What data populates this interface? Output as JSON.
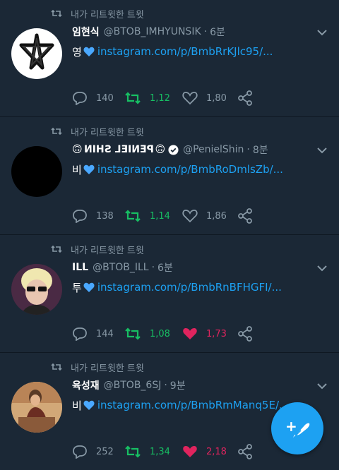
{
  "colors": {
    "background": "#1b2836",
    "link": "#1da1f2",
    "retweet_active": "#17bf63",
    "like_active": "#e0245e",
    "muted": "#8899a6"
  },
  "tweets": [
    {
      "retweet_label": "내가 리트윗한 트윗",
      "name": "임현식",
      "handle": "@BTOB_IMHYUNSIK",
      "separator": "·",
      "time": "6분",
      "text": "영",
      "link": "instagram.com/p/BmbRrKJlc95/...",
      "replies": "140",
      "retweets": "1,122",
      "likes": "1,802",
      "liked": false,
      "avatar": "star"
    },
    {
      "retweet_label": "내가 리트윗한 트윗",
      "name_emoji_left": "🙃",
      "name": "PENIEL SHIN",
      "name_emoji_right": "🙃",
      "handle": "@PenielShin",
      "separator": "·",
      "time": "8분",
      "text": "비",
      "link": "instagram.com/p/BmbRoDmlsZb/...",
      "replies": "138",
      "retweets": "1,145",
      "likes": "1,863",
      "liked": false,
      "avatar": "black",
      "verified": true
    },
    {
      "retweet_label": "내가 리트윗한 트윗",
      "name": "ILL",
      "handle": "@BTOB_ILL",
      "separator": "·",
      "time": "6분",
      "text": "투",
      "link": "instagram.com/p/BmbRnBFHGFI/...",
      "replies": "144",
      "retweets": "1,080",
      "likes": "1,731",
      "liked": true,
      "avatar": "person-blond"
    },
    {
      "retweet_label": "내가 리트윗한 트윗",
      "name": "육성재",
      "handle": "@BTOB_6SJ",
      "separator": "·",
      "time": "9분",
      "text": "비",
      "link": "instagram.com/p/BmbRmManq5E/...",
      "replies": "252",
      "retweets": "1,342",
      "likes": "2,189",
      "liked": true,
      "avatar": "person-brown"
    }
  ],
  "fab": {
    "icon": "compose-feather-plus-icon",
    "plus": "+"
  }
}
